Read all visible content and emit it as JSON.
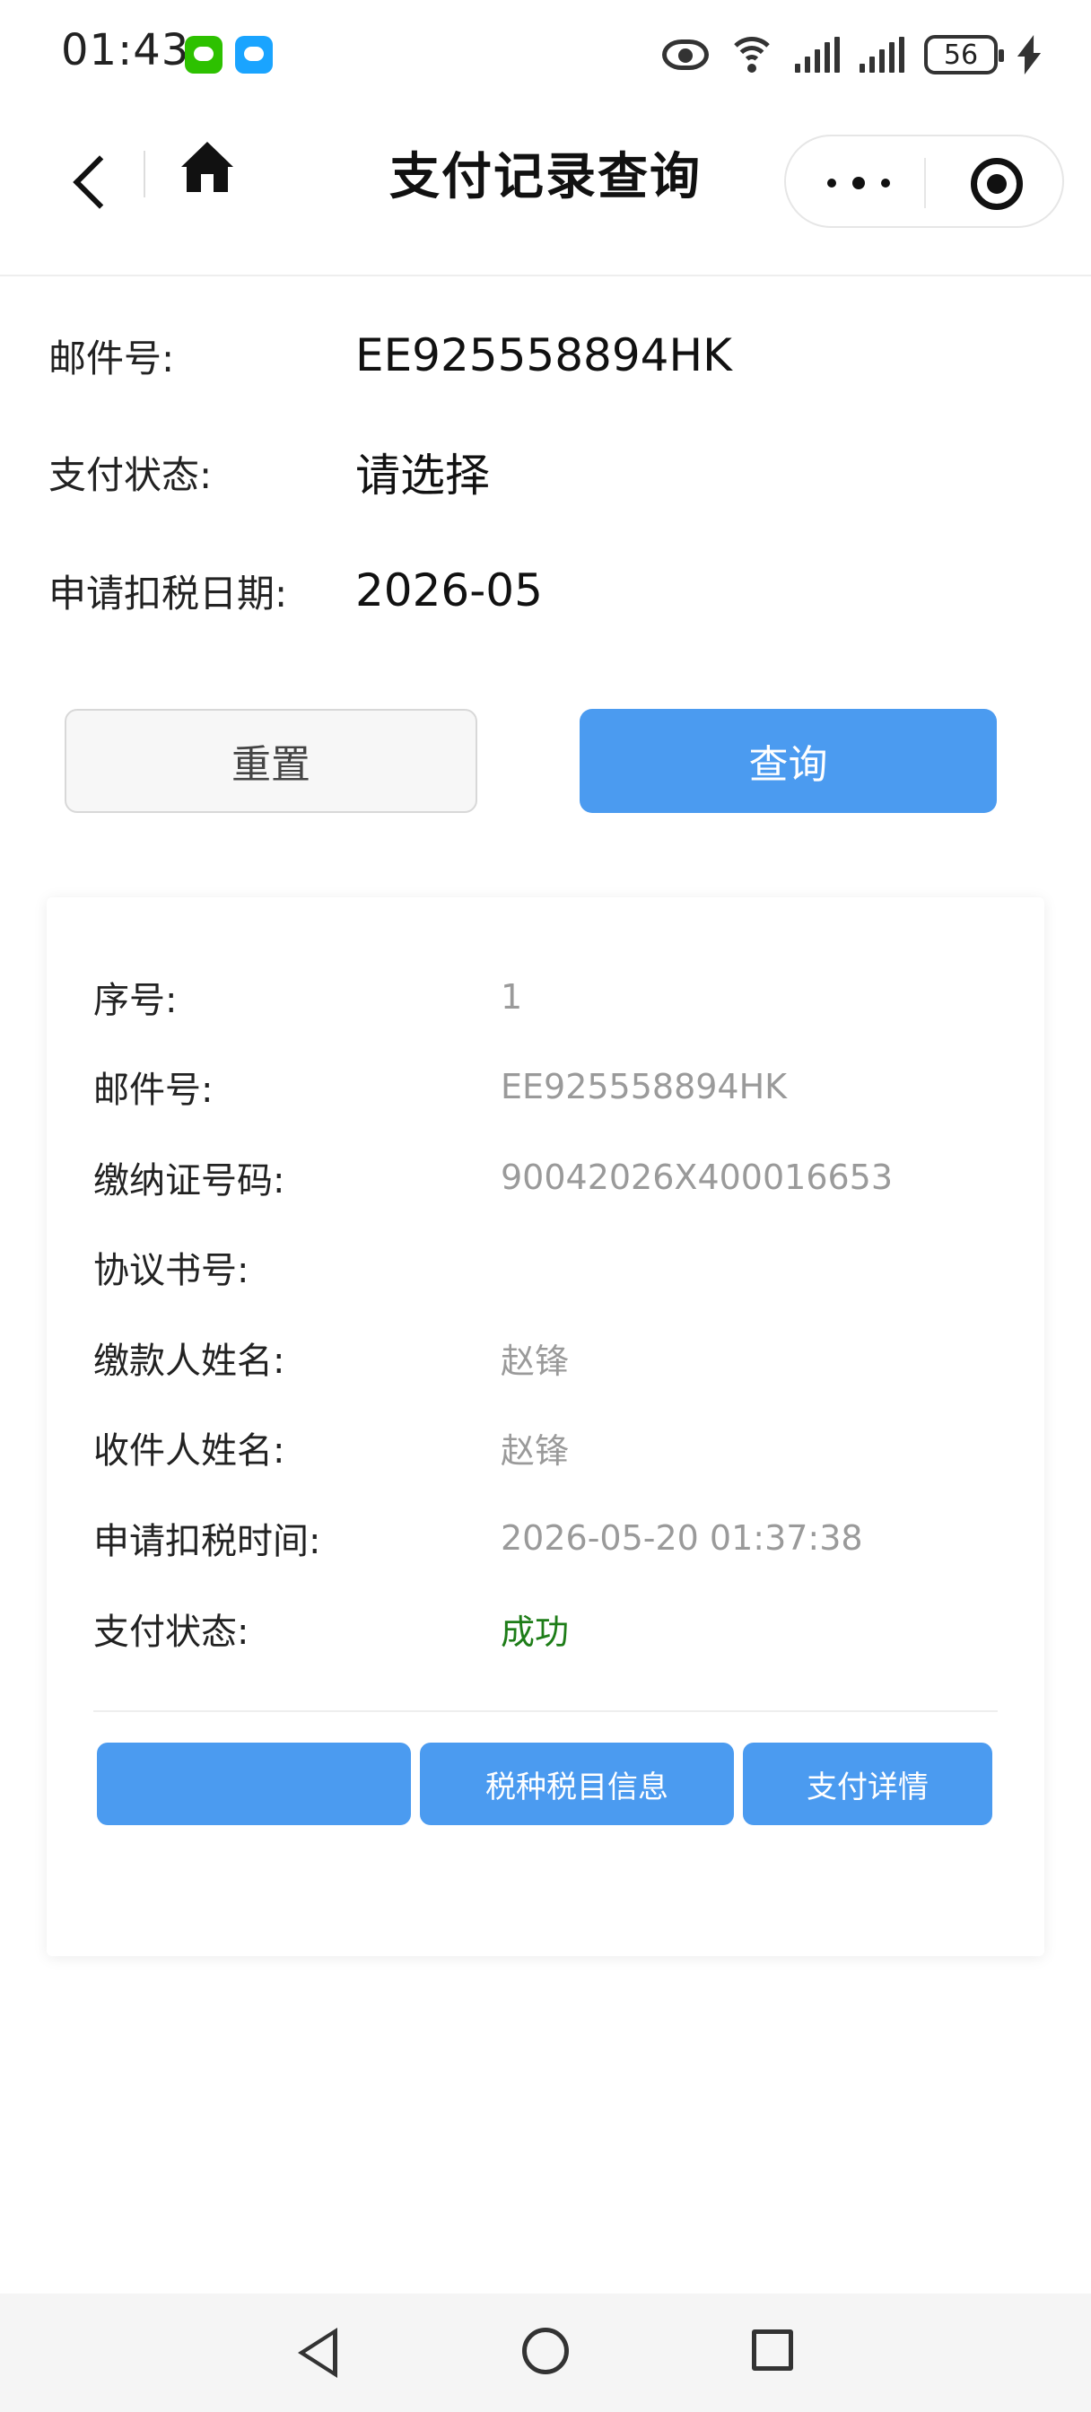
{
  "status_bar": {
    "time": "01:43",
    "battery_level": "56",
    "icons": [
      "wechat-icon",
      "message-icon",
      "eye-icon",
      "wifi-icon",
      "signal-icon",
      "signal-icon",
      "battery-icon",
      "charging-icon"
    ]
  },
  "navbar": {
    "title": "支付记录查询",
    "icons": [
      "back-icon",
      "home-icon",
      "more-icon",
      "target-icon"
    ]
  },
  "form": {
    "mail_no_label": "邮件号:",
    "mail_no_value": "EE925558894HK",
    "pay_status_label": "支付状态:",
    "pay_status_value": "请选择",
    "apply_date_label": "申请扣税日期:",
    "apply_date_value": "2026-05",
    "reset_label": "重置",
    "query_label": "查询"
  },
  "record": {
    "rows": [
      {
        "label": "序号:",
        "value": "1"
      },
      {
        "label": "邮件号:",
        "value": "EE925558894HK"
      },
      {
        "label": "缴纳证号码:",
        "value": "90042026X400016653"
      },
      {
        "label": "协议书号:",
        "value": ""
      },
      {
        "label": "缴款人姓名:",
        "value": "赵锋"
      },
      {
        "label": "收件人姓名:",
        "value": "赵锋"
      },
      {
        "label": "申请扣税时间:",
        "value": "2026-05-20 01:37:38"
      },
      {
        "label": "支付状态:",
        "value": "成功"
      }
    ],
    "buttons": [
      "",
      "税种税目信息",
      "支付详情"
    ],
    "success_color": "#1e7d18"
  },
  "theme": {
    "primary": "#4b9bf0"
  }
}
